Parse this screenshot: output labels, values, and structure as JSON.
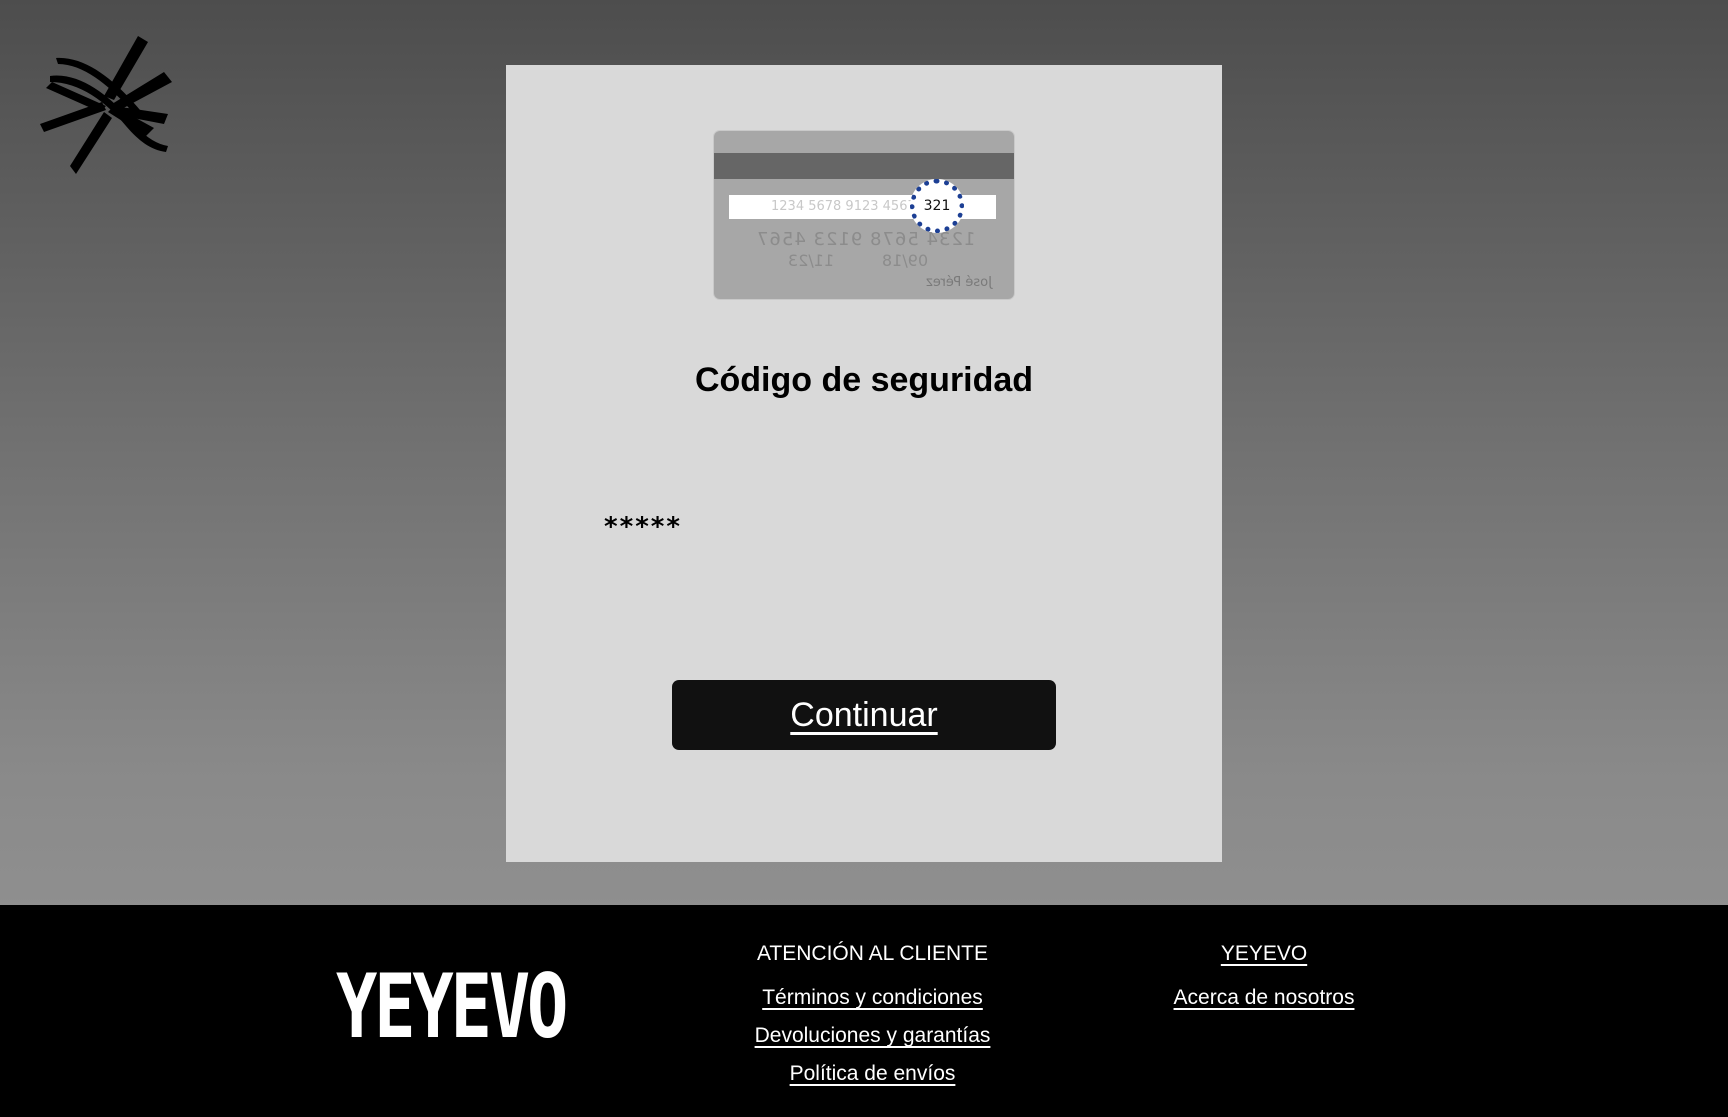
{
  "card": {
    "signature_strip": "1234 5678 9123 4567",
    "cvv": "321",
    "embossed_number": "1234 5678 9123 4567",
    "date1": "11/23",
    "date2": "09/18",
    "holder": "José Pérez"
  },
  "form": {
    "title": "Código de seguridad",
    "code_value": "*****",
    "continue_label": "Continuar"
  },
  "footer": {
    "brand": "YEYEVO",
    "customer_service": {
      "heading": "ATENCIÓN AL CLIENTE",
      "links": [
        "Términos y condiciones",
        "Devoluciones y garantías",
        "Política de envíos"
      ]
    },
    "company": {
      "heading": "YEYEVO",
      "links": [
        "Acerca de nosotros"
      ]
    }
  },
  "icons": {
    "top_left_logo": "starburst-logo-icon"
  },
  "colors": {
    "button": "#111111",
    "footer_bg": "#000000",
    "panel_bg": "#d9d9d9",
    "cvv_ring": "#1c3f94"
  }
}
